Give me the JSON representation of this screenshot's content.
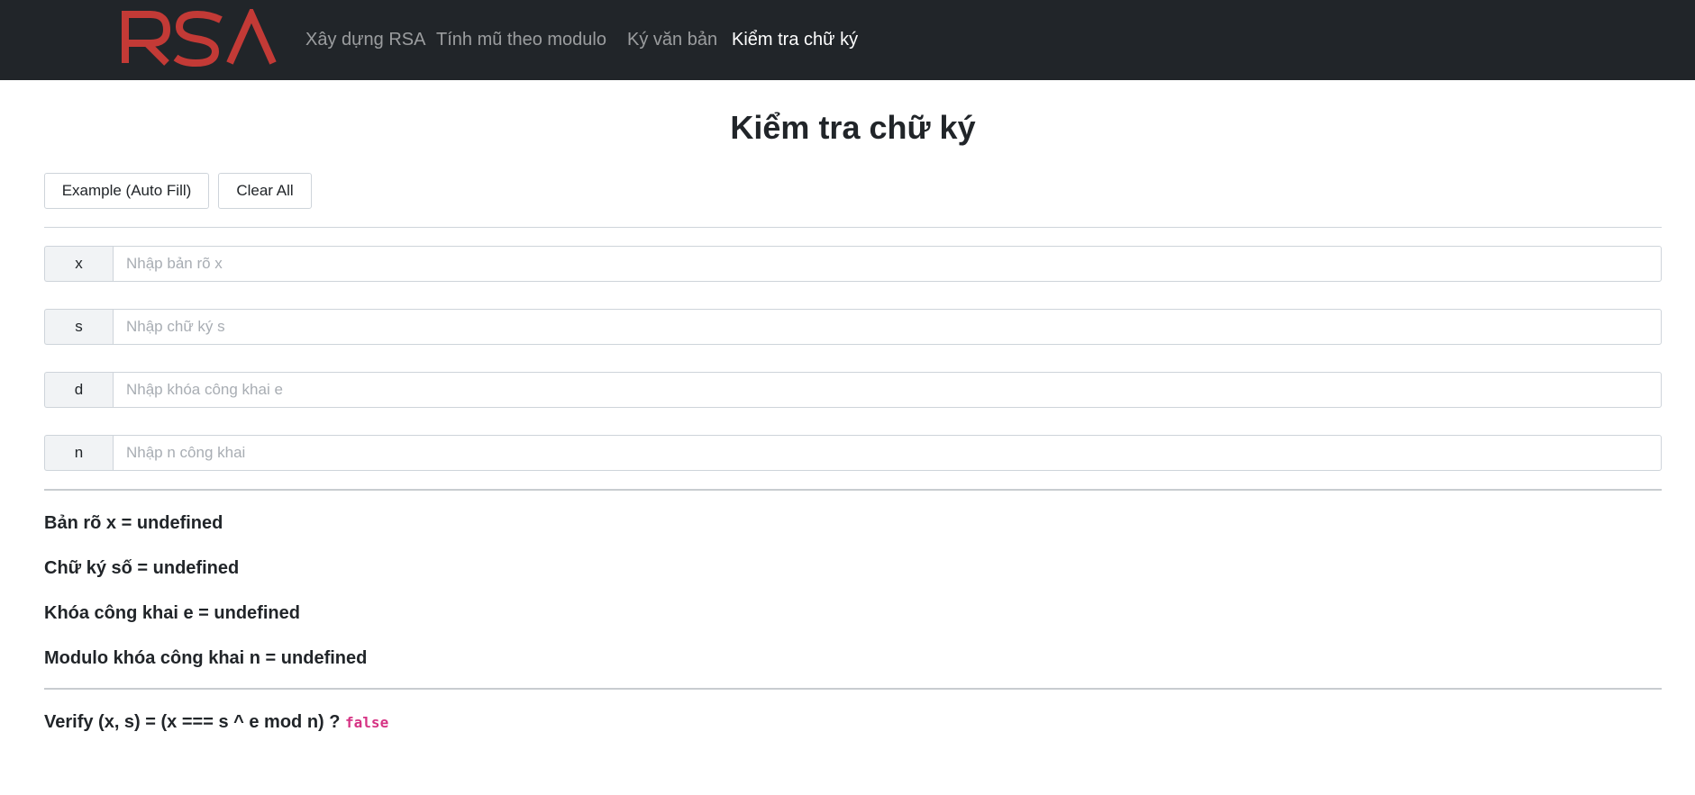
{
  "nav": {
    "brand": "RSA",
    "links": [
      {
        "label": "Xây dựng RSA",
        "active": false
      },
      {
        "label": "Tính mũ theo modulo",
        "active": false
      },
      {
        "label": "Ký văn bản",
        "active": false
      },
      {
        "label": "Kiểm tra chữ ký",
        "active": true
      }
    ]
  },
  "colors": {
    "navbar_bg": "#212529",
    "brand": "#c33a36",
    "result_false": "#d63384"
  },
  "page": {
    "title": "Kiểm tra chữ ký"
  },
  "actions": {
    "example_label": "Example (Auto Fill)",
    "clear_label": "Clear All"
  },
  "fields": [
    {
      "label": "x",
      "value": "",
      "placeholder": "Nhập bản rõ x"
    },
    {
      "label": "s",
      "value": "",
      "placeholder": "Nhập chữ ký s"
    },
    {
      "label": "d",
      "value": "",
      "placeholder": "Nhập khóa công khai e"
    },
    {
      "label": "n",
      "value": "",
      "placeholder": "Nhập n công khai"
    }
  ],
  "results": [
    "Bản rõ x = undefined",
    "Chữ ký số = undefined",
    "Khóa công khai e = undefined",
    "Modulo khóa công khai n = undefined"
  ],
  "verify": {
    "text": "Verify (x, s) = (x === s ^ e mod n) ?",
    "value": "false"
  }
}
